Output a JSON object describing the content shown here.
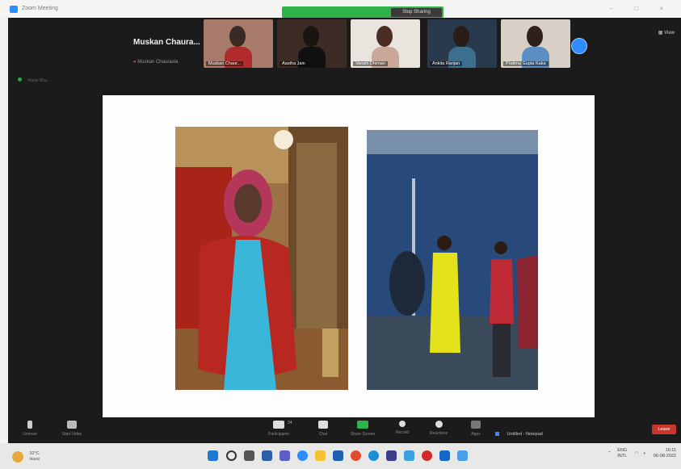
{
  "titlebar": {
    "app_title": "Zoom Meeting",
    "stop_share_label": "Stop Sharing",
    "window_controls": "– □ ×"
  },
  "speaker": {
    "name": "Muskan Chaura...",
    "subtitle": "Muskan Chaurasia"
  },
  "participants": [
    {
      "label": "Muskan Chaur..."
    },
    {
      "label": "Aastha Jain"
    },
    {
      "label": "Vanshi Dhiman"
    },
    {
      "label": "Ankita Ranjan"
    },
    {
      "label": "Pratima Gupta Kaka"
    }
  ],
  "view_label": "View",
  "mini_label": "Music Bha...",
  "toolbar": {
    "unmute": "Unmute",
    "start_video": "Start Video",
    "participants": "Participants",
    "participants_count": "24",
    "chat": "Chat",
    "share_screen": "Share Screen",
    "record": "Record",
    "reactions": "Reactions",
    "apps": "Apps",
    "leave": "Leave",
    "notepad": "Untitled - Notepad"
  },
  "taskbar": {
    "weather_temp": "32°C",
    "weather_desc": "Haze",
    "lang": "ENG",
    "lang_sub": "INTL",
    "time": "16:11",
    "date": "06-08-2022"
  },
  "colors": {
    "accent": "#2d8cff",
    "share_green": "#2fb24a",
    "leave_red": "#c8362c"
  }
}
